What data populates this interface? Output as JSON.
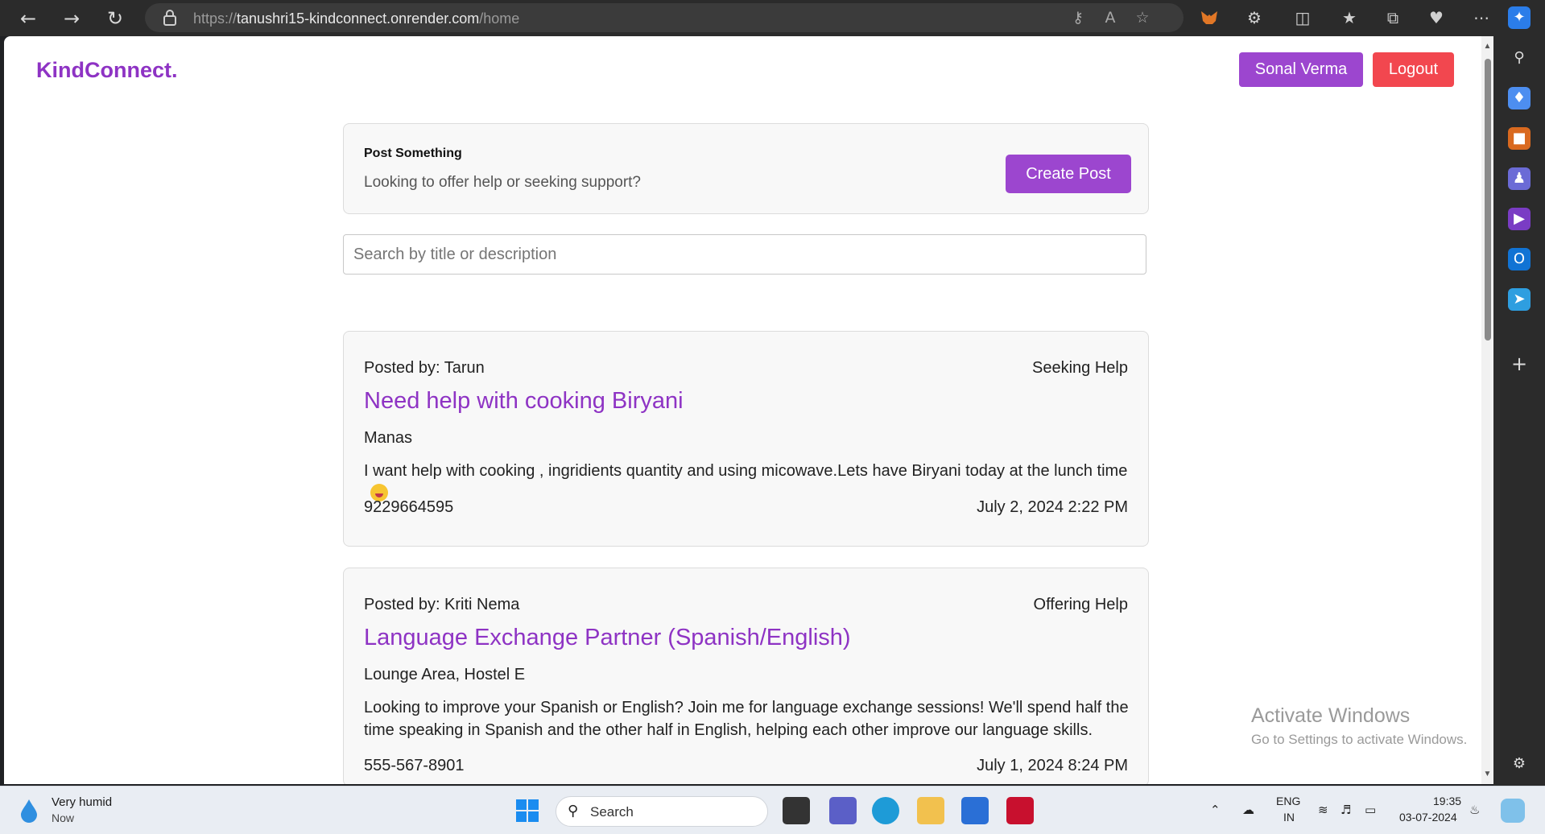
{
  "browser": {
    "url_proto": "https://",
    "url_host": "tanushri15-kindconnect.onrender.com",
    "url_path": "/home"
  },
  "header": {
    "brand": "KindConnect.",
    "user_label": "Sonal Verma",
    "logout_label": "Logout"
  },
  "composer": {
    "title": "Post Something",
    "subtitle": "Looking to offer help or seeking support?",
    "create_label": "Create Post"
  },
  "search": {
    "placeholder": "Search by title or description",
    "value": ""
  },
  "posts": [
    {
      "posted_by": "Posted by: Tarun",
      "type": "Seeking Help",
      "title": "Need help with cooking Biryani",
      "location": "Manas",
      "description": "I want help with cooking , ingridients quantity and using micowave.Lets have Biryani today at the lunch time",
      "phone": "9229664595",
      "date": "July 2, 2024 2:22 PM"
    },
    {
      "posted_by": "Posted by: Kriti Nema",
      "type": "Offering Help",
      "title": "Language Exchange Partner (Spanish/English)",
      "location": "Lounge Area, Hostel E",
      "description": "Looking to improve your Spanish or English? Join me for language exchange sessions! We'll spend half the time speaking in Spanish and the other half in English, helping each other improve our language skills.",
      "phone": "555-567-8901",
      "date": "July 1, 2024 8:24 PM"
    }
  ],
  "watermark": {
    "line1": "Activate Windows",
    "line2": "Go to Settings to activate Windows."
  },
  "taskbar": {
    "weather_line1": "Very humid",
    "weather_line2": "Now",
    "search_label": "Search",
    "lang1": "ENG",
    "lang2": "IN",
    "time": "19:35",
    "date": "03-07-2024"
  },
  "colors": {
    "brand": "#8e33c4",
    "primary_button": "#9c46cf",
    "logout_button": "#f2474f"
  }
}
